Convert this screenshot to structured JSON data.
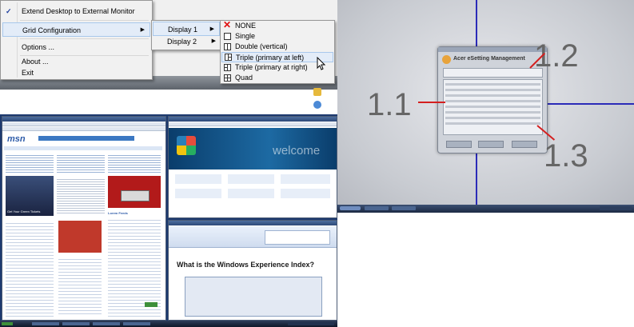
{
  "context_menu": {
    "items": [
      {
        "label": "Extend Desktop to External Monitor",
        "checked": true
      },
      {
        "label": "Grid Configuration",
        "has_submenu": true
      },
      {
        "label": "Options ..."
      },
      {
        "label": "About ..."
      },
      {
        "label": "Exit"
      }
    ]
  },
  "display_menu": {
    "items": [
      {
        "label": "Display 1",
        "has_submenu": true,
        "highlighted": true
      },
      {
        "label": "Display 2",
        "has_submenu": true
      }
    ]
  },
  "layout_menu": {
    "items": [
      {
        "label": "NONE",
        "icon": "red-x-icon"
      },
      {
        "label": "Single",
        "icon": "single-layout-icon"
      },
      {
        "label": "Double (vertical)",
        "icon": "double-vertical-layout-icon"
      },
      {
        "label": "Triple (primary at left)",
        "icon": "triple-left-layout-icon",
        "hovered": true
      },
      {
        "label": "Triple (primary at right)",
        "icon": "triple-right-layout-icon"
      },
      {
        "label": "Quad",
        "icon": "quad-layout-icon"
      }
    ]
  },
  "monitor_preview": {
    "labels": [
      "1.1",
      "1.2",
      "1.3"
    ],
    "app_title": "Acer eSetting Management",
    "grid_line_color": "#2b2bb8",
    "pointer_color": "#d41f1f"
  },
  "desktop_screens": {
    "left_window": {
      "site": "msn",
      "news_headline": "Get Your Green Tickets",
      "section": "Lorem Feeds"
    },
    "right_top_window": {
      "brand_text": "welcome"
    },
    "right_bottom_window": {
      "headline": "What is the Windows Experience Index?"
    }
  },
  "colors": {
    "menu_bg": "#f1f1f1",
    "menu_highlight": "#e3ecf8",
    "desktop_blue": "#1d3a6f",
    "vista_green": "#3d8f3a"
  }
}
